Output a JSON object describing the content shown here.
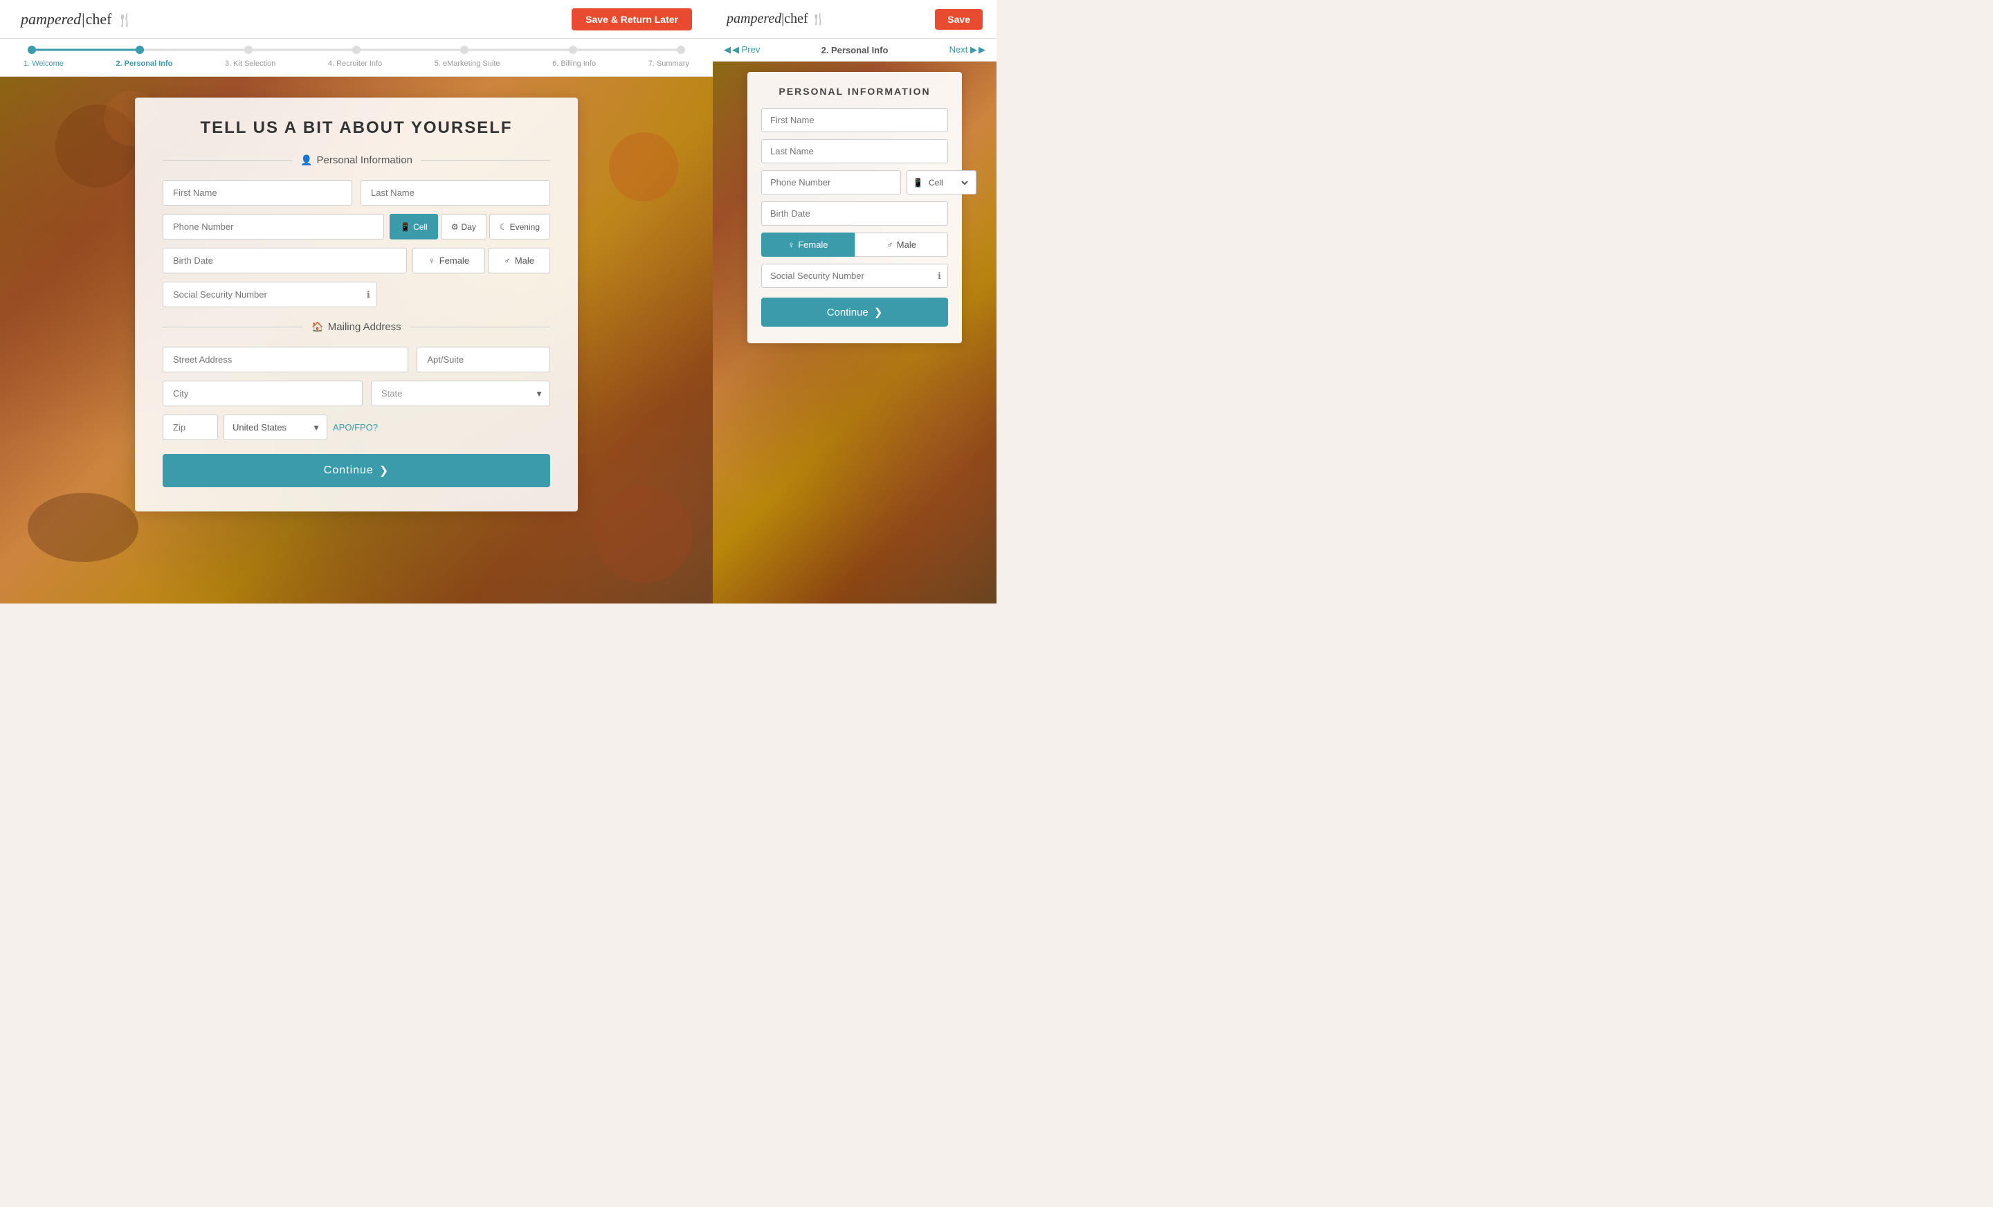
{
  "header": {
    "logo_text": "pampered|chef",
    "logo_part1": "pampered",
    "logo_pipe": "|",
    "logo_part2": "chef",
    "save_return_label": "Save & Return Later",
    "save_label": "Save"
  },
  "progress": {
    "steps": [
      {
        "label": "1. Welcome",
        "state": "completed"
      },
      {
        "label": "2. Personal Info",
        "state": "active"
      },
      {
        "label": "3. Kit Selection",
        "state": "upcoming"
      },
      {
        "label": "4. Recruiter Info",
        "state": "upcoming"
      },
      {
        "label": "5. eMarketing Suite",
        "state": "upcoming"
      },
      {
        "label": "6. Billing Info",
        "state": "upcoming"
      },
      {
        "label": "7. Summary",
        "state": "upcoming"
      }
    ]
  },
  "sidebar_nav": {
    "prev_label": "◀ Prev",
    "title": "2. Personal Info",
    "next_label": "Next ▶"
  },
  "form": {
    "title": "TELL US A BIT ABOUT YOURSELF",
    "personal_info_section": "Personal Information",
    "mailing_address_section": "Mailing Address",
    "first_name_placeholder": "First Name",
    "last_name_placeholder": "Last Name",
    "phone_placeholder": "Phone Number",
    "phone_types": [
      {
        "label": "Cell",
        "icon": "📱",
        "active": true
      },
      {
        "label": "Day",
        "icon": "⚙",
        "active": false
      },
      {
        "label": "Evening",
        "icon": "🌙",
        "active": false
      }
    ],
    "birth_date_placeholder": "Birth Date",
    "gender_female": "Female",
    "gender_male": "Male",
    "ssn_placeholder": "Social Security Number",
    "street_address_placeholder": "Street Address",
    "apt_suite_placeholder": "Apt/Suite",
    "city_placeholder": "City",
    "state_placeholder": "State",
    "zip_placeholder": "Zip",
    "country_value": "United States",
    "apo_link": "APO/FPO?",
    "continue_label": "Continue",
    "continue_arrow": "❯"
  },
  "sidebar_form": {
    "title": "PERSONAL INFORMATION",
    "first_name_placeholder": "First Name",
    "last_name_placeholder": "Last Name",
    "phone_placeholder": "Phone Number",
    "phone_type": "Cell",
    "birth_date_placeholder": "Birth Date",
    "gender_female": "Female",
    "gender_male": "Male",
    "ssn_placeholder": "Social Security Number",
    "continue_label": "Continue",
    "continue_arrow": "❯"
  },
  "colors": {
    "teal": "#3a9baa",
    "orange_red": "#e84b2e",
    "text_dark": "#333",
    "text_light": "#999",
    "border": "#ccc"
  }
}
